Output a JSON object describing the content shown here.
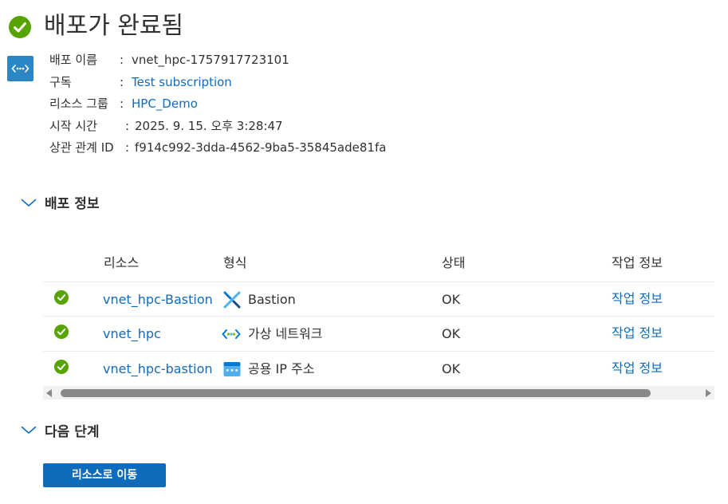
{
  "header": {
    "title": "배포가 완료됨"
  },
  "details": {
    "deployment_name": {
      "label": "배포 이름",
      "sep": ":",
      "value": "vnet_hpc-1757917723101"
    },
    "subscription": {
      "label": "구독",
      "sep": ":",
      "value": "Test subscription"
    },
    "resource_group": {
      "label": "리소스 그룹",
      "sep": ":",
      "value": "HPC_Demo"
    },
    "start_time": {
      "label": "시작 시간",
      "sep": ":",
      "value": "2025. 9. 15. 오후 3:28:47"
    },
    "correlation_id": {
      "label": "상관 관계 ID",
      "sep": ":",
      "value": "f914c992-3dda-4562-9ba5-35845ade81fa"
    }
  },
  "deployment_info": {
    "title": "배포 정보",
    "columns": {
      "resource": "리소스",
      "type": "형식",
      "status": "상태",
      "operation": "작업 정보"
    },
    "rows": [
      {
        "resource": "vnet_hpc-Bastion",
        "type": "Bastion",
        "type_icon": "bastion-icon",
        "status": "OK",
        "operation": "작업 정보"
      },
      {
        "resource": "vnet_hpc",
        "type": "가상 네트워크",
        "type_icon": "virtual-network-icon",
        "status": "OK",
        "operation": "작업 정보"
      },
      {
        "resource": "vnet_hpc-bastion",
        "type": "공용 IP 주소",
        "type_icon": "public-ip-icon",
        "status": "OK",
        "operation": "작업 정보"
      }
    ]
  },
  "next_steps": {
    "title": "다음 단계",
    "go_button": "리소스로 이동"
  },
  "colors": {
    "success": "#57a300",
    "link": "#0f6cbd",
    "primary_button": "#0f6cbd",
    "vnet_tile": "#2d86c4"
  }
}
